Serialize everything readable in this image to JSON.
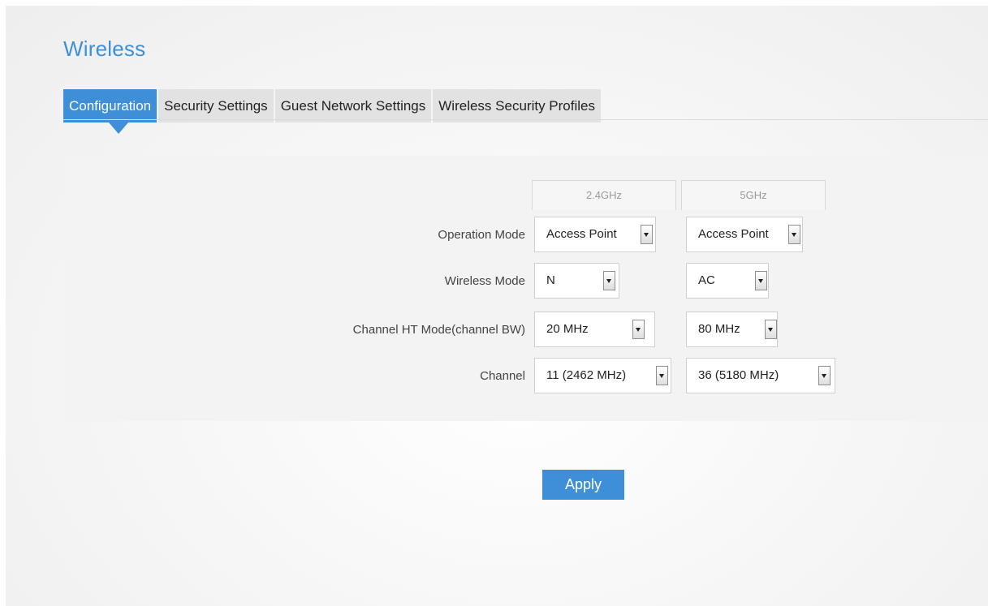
{
  "page": {
    "title": "Wireless"
  },
  "tabs": [
    {
      "label": "Configuration",
      "active": true
    },
    {
      "label": "Security Settings",
      "active": false
    },
    {
      "label": "Guest Network Settings",
      "active": false
    },
    {
      "label": "Wireless Security Profiles",
      "active": false
    }
  ],
  "bands": {
    "band_24": "2.4GHz",
    "band_5": "5GHz"
  },
  "rows": [
    {
      "label": "Operation Mode",
      "value_24": "Access Point",
      "value_5": "Access Point"
    },
    {
      "label": "Wireless Mode",
      "value_24": "N",
      "value_5": "AC"
    },
    {
      "label": "Channel HT Mode(channel BW)",
      "value_24": "20 MHz",
      "value_5": "80 MHz"
    },
    {
      "label": "Channel",
      "value_24": "11 (2462 MHz)",
      "value_5": "36 (5180 MHz)"
    }
  ],
  "actions": {
    "apply_label": "Apply"
  },
  "colors": {
    "accent": "#3f8fd8",
    "title": "#3d8fd6",
    "tab_inactive": "#e2e2e2",
    "panel": "#f3f3f3"
  },
  "icons": {
    "select_arrow": "chevron-down-icon"
  }
}
